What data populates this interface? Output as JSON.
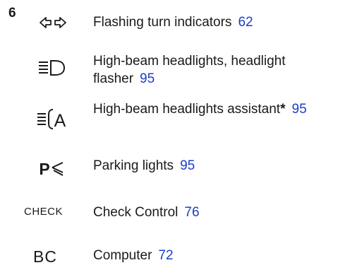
{
  "section_number": "6",
  "entries": [
    {
      "icon": "turn-indicators-icon",
      "text": "Flashing turn indicators",
      "page": "62"
    },
    {
      "icon": "high-beam-icon",
      "text": "High-beam headlights, headlight flasher",
      "page": "95"
    },
    {
      "icon": "high-beam-assistant-icon",
      "text": "High-beam headlights assistant",
      "marker": "*",
      "page": "95"
    },
    {
      "icon": "parking-lights-icon",
      "text": "Parking lights",
      "page": "95"
    },
    {
      "icon": "check-control-icon",
      "icon_label": "CHECK",
      "text": "Check Control",
      "page": "76"
    },
    {
      "icon": "computer-icon",
      "icon_label": "BC",
      "text": "Computer",
      "page": "72"
    }
  ]
}
